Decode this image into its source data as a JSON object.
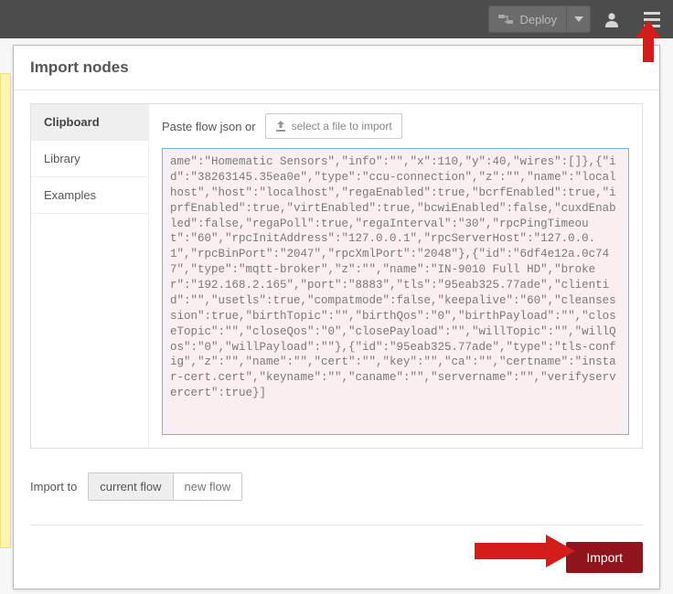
{
  "topbar": {
    "deploy_label": "Deploy"
  },
  "dialog": {
    "title": "Import nodes",
    "tabs": [
      "Clipboard",
      "Library",
      "Examples"
    ],
    "paste_label": "Paste flow json or",
    "file_button": "select a file to import",
    "json_text": "ame\":\"Homematic Sensors\",\"info\":\"\",\"x\":110,\"y\":40,\"wires\":[]},{\"id\":\"38263145.35ea0e\",\"type\":\"ccu-connection\",\"z\":\"\",\"name\":\"localhost\",\"host\":\"localhost\",\"regaEnabled\":true,\"bcrfEnabled\":true,\"iprfEnabled\":true,\"virtEnabled\":true,\"bcwiEnabled\":false,\"cuxdEnabled\":false,\"regaPoll\":true,\"regaInterval\":\"30\",\"rpcPingTimeout\":\"60\",\"rpcInitAddress\":\"127.0.0.1\",\"rpcServerHost\":\"127.0.0.1\",\"rpcBinPort\":\"2047\",\"rpcXmlPort\":\"2048\"},{\"id\":\"6df4e12a.0c747\",\"type\":\"mqtt-broker\",\"z\":\"\",\"name\":\"IN-9010 Full HD\",\"broker\":\"192.168.2.165\",\"port\":\"8883\",\"tls\":\"95eab325.77ade\",\"clientid\":\"\",\"usetls\":true,\"compatmode\":false,\"keepalive\":\"60\",\"cleansession\":true,\"birthTopic\":\"\",\"birthQos\":\"0\",\"birthPayload\":\"\",\"closeTopic\":\"\",\"closeQos\":\"0\",\"closePayload\":\"\",\"willTopic\":\"\",\"willQos\":\"0\",\"willPayload\":\"\"},{\"id\":\"95eab325.77ade\",\"type\":\"tls-config\",\"z\":\"\",\"name\":\"\",\"cert\":\"\",\"key\":\"\",\"ca\":\"\",\"certname\":\"instar-cert.cert\",\"keyname\":\"\",\"caname\":\"\",\"servername\":\"\",\"verifyservercert\":true}]",
    "import_to_label": "Import to",
    "seg_current": "current flow",
    "seg_new": "new flow",
    "import_button": "Import"
  },
  "colors": {
    "arrow": "#d41c1c",
    "import_btn": "#90141b"
  }
}
